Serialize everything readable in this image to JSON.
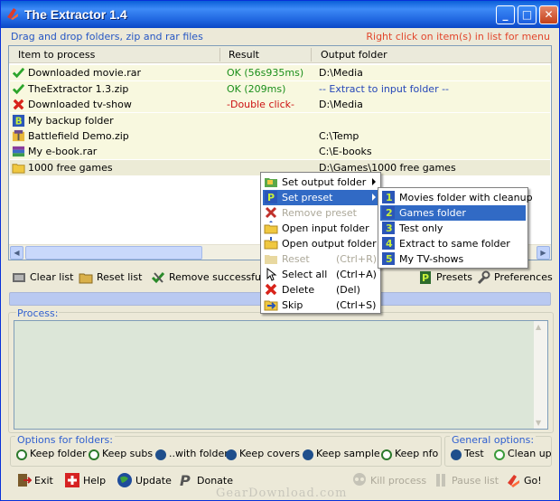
{
  "window": {
    "title": "The Extractor 1.4",
    "minimize": "_",
    "maximize": "□",
    "close": "✕"
  },
  "hints": {
    "left": "Drag and drop folders, zip and rar files",
    "right": "Right click on item(s) in list for menu"
  },
  "list": {
    "columns": [
      "Item to process",
      "Result",
      "Output folder"
    ],
    "rows": [
      {
        "icon": "check-icon",
        "item": "Downloaded movie.rar",
        "result": "OK (56s935ms)",
        "output": "D:\\Media"
      },
      {
        "icon": "check-icon",
        "item": "TheExtractor 1.3.zip",
        "result": "OK (209ms)",
        "output": "-- Extract to input folder --"
      },
      {
        "icon": "error-icon",
        "item": "Downloaded tv-show",
        "result": "-Double click-",
        "output": "D:\\Media"
      },
      {
        "icon": "preset-icon",
        "item": "My backup folder",
        "result": "",
        "output": ""
      },
      {
        "icon": "zip-icon",
        "item": "Battlefield Demo.zip",
        "result": "",
        "output": "C:\\Temp"
      },
      {
        "icon": "rar-icon",
        "item": "My e-book.rar",
        "result": "",
        "output": "C:\\E-books"
      },
      {
        "icon": "folder-icon",
        "item": "1000 free games",
        "result": "",
        "output": "D:\\Games\\1000 free games"
      }
    ]
  },
  "toolbar": {
    "clear": "Clear list",
    "reset": "Reset list",
    "remove": "Remove successful",
    "presets": "Presets",
    "preferences": "Preferences"
  },
  "process": {
    "label": "Process:"
  },
  "folder_options": {
    "label": "Options for folders:",
    "items": [
      "Keep folder",
      "Keep subs",
      "..with folder",
      "Keep covers",
      "Keep sample",
      "Keep nfo"
    ]
  },
  "general_options": {
    "label": "General options:",
    "items": [
      "Test",
      "Clean up"
    ]
  },
  "bottom": {
    "exit": "Exit",
    "help": "Help",
    "update": "Update",
    "donate": "Donate",
    "kill": "Kill process",
    "pause": "Pause list",
    "go": "Go!"
  },
  "context_menu": {
    "items": [
      {
        "label": "Set output folder",
        "shortcut": ""
      },
      {
        "label": "Set preset",
        "shortcut": ""
      },
      {
        "label": "Remove preset",
        "shortcut": ""
      },
      {
        "label": "Open input folder",
        "shortcut": ""
      },
      {
        "label": "Open output folder",
        "shortcut": ""
      },
      {
        "label": "Reset",
        "shortcut": "(Ctrl+R)"
      },
      {
        "label": "Select all",
        "shortcut": "(Ctrl+A)"
      },
      {
        "label": "Delete",
        "shortcut": "(Del)"
      },
      {
        "label": "Skip",
        "shortcut": "(Ctrl+S)"
      }
    ]
  },
  "submenu": {
    "items": [
      "Movies folder with cleanup",
      "Games folder",
      "Test only",
      "Extract to same folder",
      "My TV-shows"
    ]
  },
  "watermark": "GearDownload.com",
  "colors": {
    "title_bar": "#0a5fd8",
    "ok_text": "#1b8f1b",
    "error_text": "#cc1010",
    "highlight": "#316ac5",
    "hint_left": "#2556c4",
    "hint_right": "#e2462c"
  }
}
